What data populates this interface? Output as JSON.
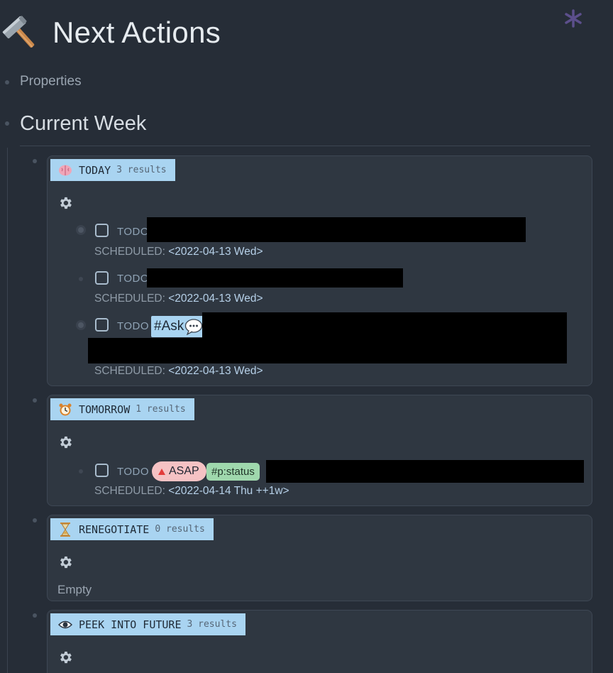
{
  "page": {
    "title": "Next Actions",
    "icon": "hammer-icon",
    "properties_label": "Properties",
    "section_heading": "Current Week"
  },
  "colors": {
    "background": "#262d37",
    "card": "#2f3741",
    "query_header": "#a9d4f1",
    "tag_asap": "#f5c2c4",
    "tag_status": "#9fd8ad"
  },
  "queries": [
    {
      "emoji": "brain-icon",
      "title": "TODAY",
      "count": "3 results",
      "items": [
        {
          "marker": "TODO",
          "scheduled_key": "SCHEDULED:",
          "scheduled_value": "<2022-04-13 Wed>"
        },
        {
          "marker": "TODO",
          "scheduled_key": "SCHEDULED:",
          "scheduled_value": "<2022-04-13 Wed>"
        },
        {
          "marker": "TODO",
          "tag": "#Ask",
          "scheduled_key": "SCHEDULED:",
          "scheduled_value": "<2022-04-13 Wed>"
        }
      ]
    },
    {
      "emoji": "alarm-clock-icon",
      "title": "TOMORROW",
      "count": "1 results",
      "items": [
        {
          "marker": "TODO",
          "priority": "ASAP",
          "tag": "#p:status",
          "scheduled_key": "SCHEDULED:",
          "scheduled_value": "<2022-04-14 Thu ++1w>"
        }
      ]
    },
    {
      "emoji": "hourglass-icon",
      "title": "RENEGOTIATE",
      "count": "0 results",
      "empty_label": "Empty"
    },
    {
      "emoji": "eye-icon",
      "title": "PEEK INTO FUTURE",
      "count": "3 results"
    }
  ]
}
